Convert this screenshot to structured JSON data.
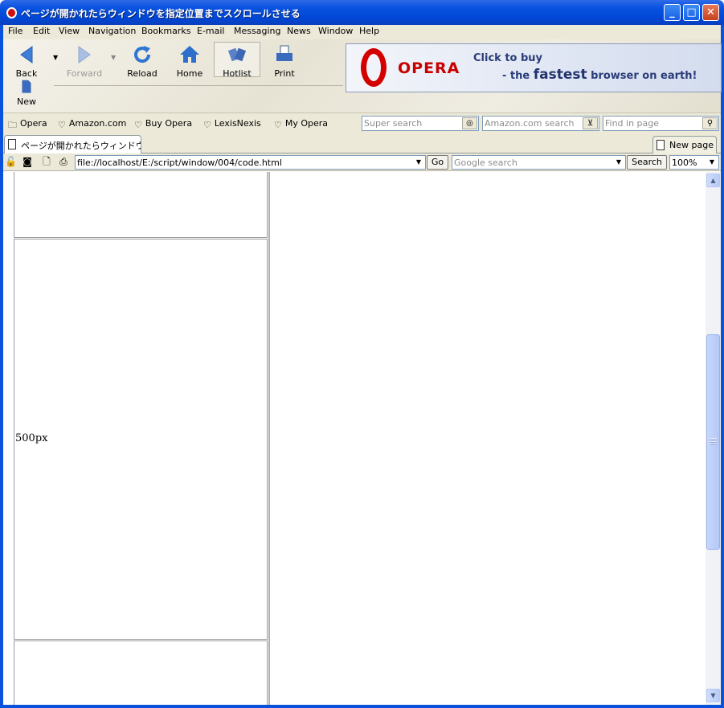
{
  "window": {
    "title": "ページが開かれたらウィンドウを指定位置までスクロールさせる",
    "minimize": "_",
    "maximize": "□",
    "close": "✕"
  },
  "menu": [
    "File",
    "Edit",
    "View",
    "Navigation",
    "Bookmarks",
    "E-mail",
    "Messaging",
    "News",
    "Window",
    "Help"
  ],
  "toolbar": {
    "back": "Back",
    "forward": "Forward",
    "reload": "Reload",
    "home": "Home",
    "hotlist": "Hotlist",
    "print": "Print",
    "new": "New"
  },
  "banner": {
    "brand": "OPERA",
    "line1": "Click to buy",
    "line2_pre": "- the ",
    "line2_big": "fastest",
    "line2_post": " browser on earth!"
  },
  "bookmarks": {
    "items": [
      "Opera",
      "Amazon.com",
      "Buy Opera",
      "LexisNexis",
      "My Opera"
    ],
    "super_search_placeholder": "Super search",
    "amazon_search_placeholder": "Amazon.com search",
    "find_placeholder": "Find in page"
  },
  "tabs": {
    "active": "ページが開かれたらウィンドウを…",
    "new_page": "New page"
  },
  "address": {
    "url": "file://localhost/E:/script/window/004/code.html",
    "go": "Go",
    "google_placeholder": "Google search",
    "search": "Search",
    "zoom": "100%"
  },
  "page": {
    "cell_label": "500px"
  },
  "colors": {
    "titlebar": "#0a53e0",
    "chrome": "#ece9d8",
    "opera_red": "#d40000",
    "banner_text": "#2a3b78"
  }
}
